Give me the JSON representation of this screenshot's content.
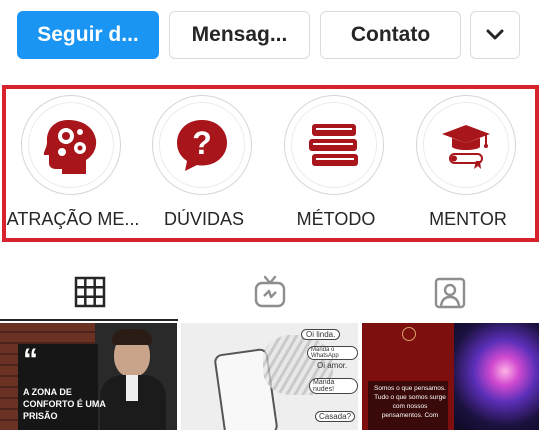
{
  "buttons": {
    "follow": "Seguir d...",
    "message": "Mensag...",
    "contact": "Contato",
    "more_icon": "chevron-down-icon"
  },
  "highlights": [
    {
      "label": "ATRAÇÃO ME...",
      "icon": "brain-gears-icon"
    },
    {
      "label": "DÚVIDAS",
      "icon": "question-bubble-icon"
    },
    {
      "label": "MÉTODO",
      "icon": "books-icon"
    },
    {
      "label": "MENTOR",
      "icon": "graduation-cap-icon"
    }
  ],
  "tabs": [
    {
      "icon": "grid-icon",
      "active": true
    },
    {
      "icon": "igtv-icon",
      "active": false
    },
    {
      "icon": "tagged-icon",
      "active": false
    }
  ],
  "posts": {
    "post1": {
      "quote": "“",
      "text": [
        "A ZONA DE",
        "CONFORTO É UMA",
        "PRISÃO"
      ]
    },
    "post2": {
      "bubbles": [
        "Oi linda.",
        "Manda o WhatsApp",
        "Oi amor.",
        "Manda nudes!",
        "Casada?"
      ]
    },
    "post3": {
      "text": [
        "Somos o que pensamos.",
        "Tudo o que somos surge",
        "com nossos",
        "pensamentos. Com"
      ]
    }
  },
  "colors": {
    "primary": "#1a95f3",
    "highlight_border": "#d8232f",
    "icon": "#a8151b"
  }
}
